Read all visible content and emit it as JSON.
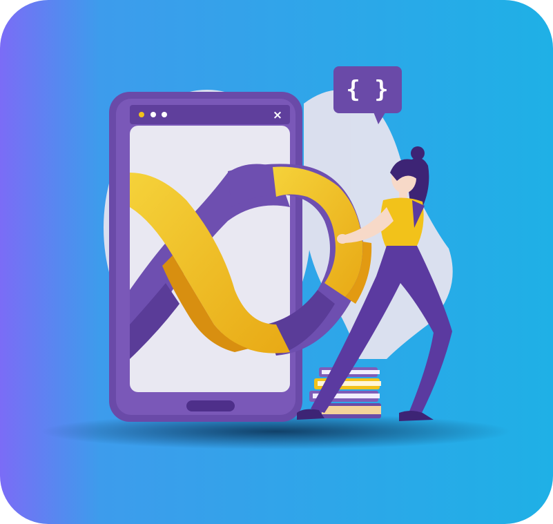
{
  "illustration": {
    "code_bubble_text": "{ }",
    "window_close_glyph": "×",
    "subject": "devops-infinity-loop",
    "colors": {
      "bg_gradient_start": "#7b6cf6",
      "bg_gradient_end": "#1fb0e6",
      "phone_body": "#6a4aa8",
      "phone_screen": "#e9e8f2",
      "loop_purple": "#6e4fb0",
      "loop_yellow": "#f2c21a",
      "loop_orange": "#e29a12",
      "backdrop_shape": "#e4e3ef",
      "person_pants": "#5b3aa0",
      "person_shirt": "#f2c21a",
      "book_cover": "#7e5cb8"
    }
  }
}
